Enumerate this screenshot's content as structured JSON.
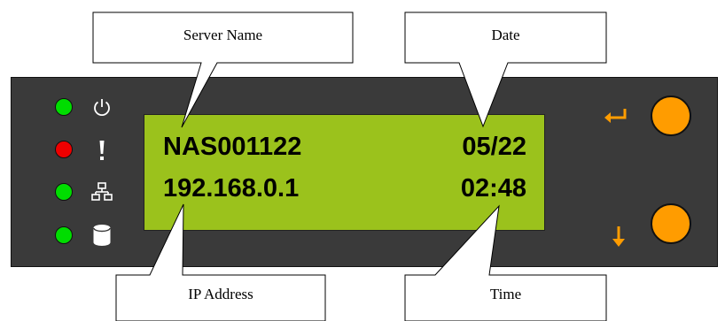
{
  "lcd": {
    "server_name": "NAS001122",
    "date": "05/22",
    "ip_address": "192.168.0.1",
    "time": "02:48"
  },
  "callouts": {
    "server_name": "Server Name",
    "date": "Date",
    "ip_address": "IP Address",
    "time": "Time"
  },
  "leds": [
    {
      "icon": "power-icon",
      "color": "#00dd00"
    },
    {
      "icon": "alert-icon",
      "color": "#ee0000"
    },
    {
      "icon": "network-icon",
      "color": "#00dd00"
    },
    {
      "icon": "disk-icon",
      "color": "#00dd00"
    }
  ],
  "buttons": [
    {
      "icon": "enter-arrow-icon",
      "color": "#ff9c00"
    },
    {
      "icon": "down-arrow-icon",
      "color": "#ff9c00"
    }
  ],
  "colors": {
    "panel": "#3a3a3a",
    "lcd": "#9bc21c",
    "accent": "#ff9c00"
  }
}
